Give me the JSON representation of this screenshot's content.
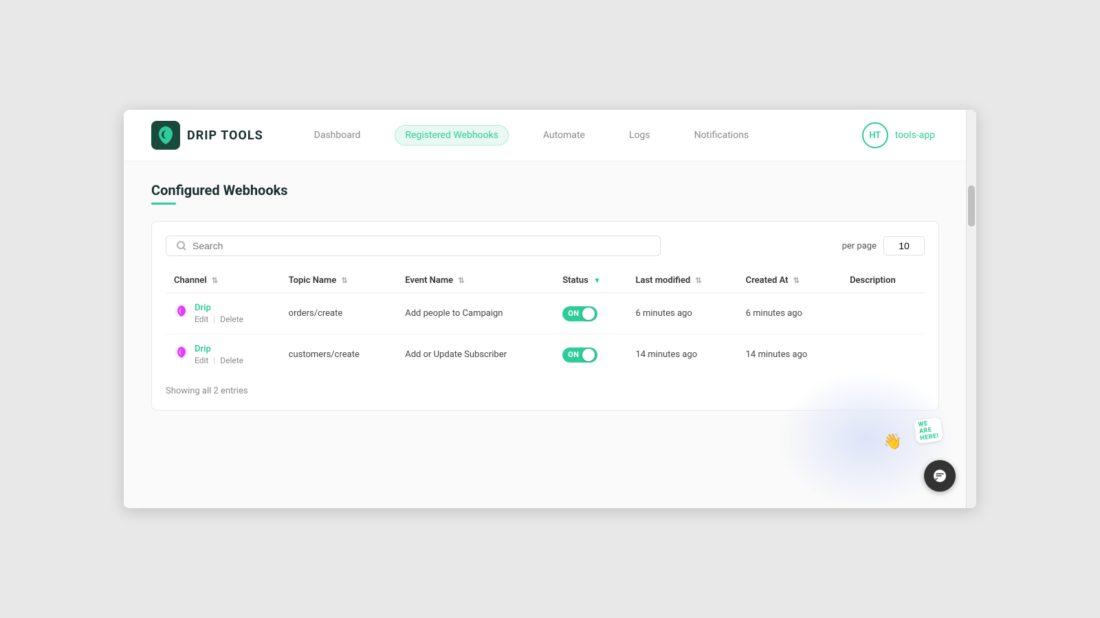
{
  "app": {
    "title": "DRIP TOOLS",
    "user_initials": "HT",
    "user_label": "tools-app"
  },
  "nav": {
    "items": [
      {
        "id": "dashboard",
        "label": "Dashboard",
        "active": false
      },
      {
        "id": "registered-webhooks",
        "label": "Registered Webhooks",
        "active": true
      },
      {
        "id": "automate",
        "label": "Automate",
        "active": false
      },
      {
        "id": "logs",
        "label": "Logs",
        "active": false
      },
      {
        "id": "notifications",
        "label": "Notifications",
        "active": false
      }
    ]
  },
  "page": {
    "title": "Configured Webhooks"
  },
  "table": {
    "search_placeholder": "Search",
    "per_page_label": "per page",
    "per_page_value": "10",
    "columns": [
      {
        "id": "channel",
        "label": "Channel",
        "sortable": true
      },
      {
        "id": "topic_name",
        "label": "Topic Name",
        "sortable": true
      },
      {
        "id": "event_name",
        "label": "Event Name",
        "sortable": true
      },
      {
        "id": "status",
        "label": "Status",
        "sortable": true,
        "active_sort": true
      },
      {
        "id": "last_modified",
        "label": "Last modified",
        "sortable": true
      },
      {
        "id": "created_at",
        "label": "Created At",
        "sortable": true
      },
      {
        "id": "description",
        "label": "Description",
        "sortable": false
      }
    ],
    "rows": [
      {
        "channel_name": "Drip",
        "topic_name": "orders/create",
        "event_name": "Add people to Campaign",
        "status": "ON",
        "last_modified": "6 minutes ago",
        "created_at": "6 minutes ago",
        "description": "",
        "edit_label": "Edit",
        "delete_label": "Delete"
      },
      {
        "channel_name": "Drip",
        "topic_name": "customers/create",
        "event_name": "Add or Update Subscriber",
        "status": "ON",
        "last_modified": "14 minutes ago",
        "created_at": "14 minutes ago",
        "description": "",
        "edit_label": "Edit",
        "delete_label": "Delete"
      }
    ],
    "footer_text": "Showing all 2 entries"
  },
  "chat": {
    "badge_text": "We Are Here!",
    "emoji": "👋"
  },
  "colors": {
    "accent": "#2ecc9a",
    "text_dark": "#1a2e2e",
    "drip_icon_color": "#e040fb"
  }
}
